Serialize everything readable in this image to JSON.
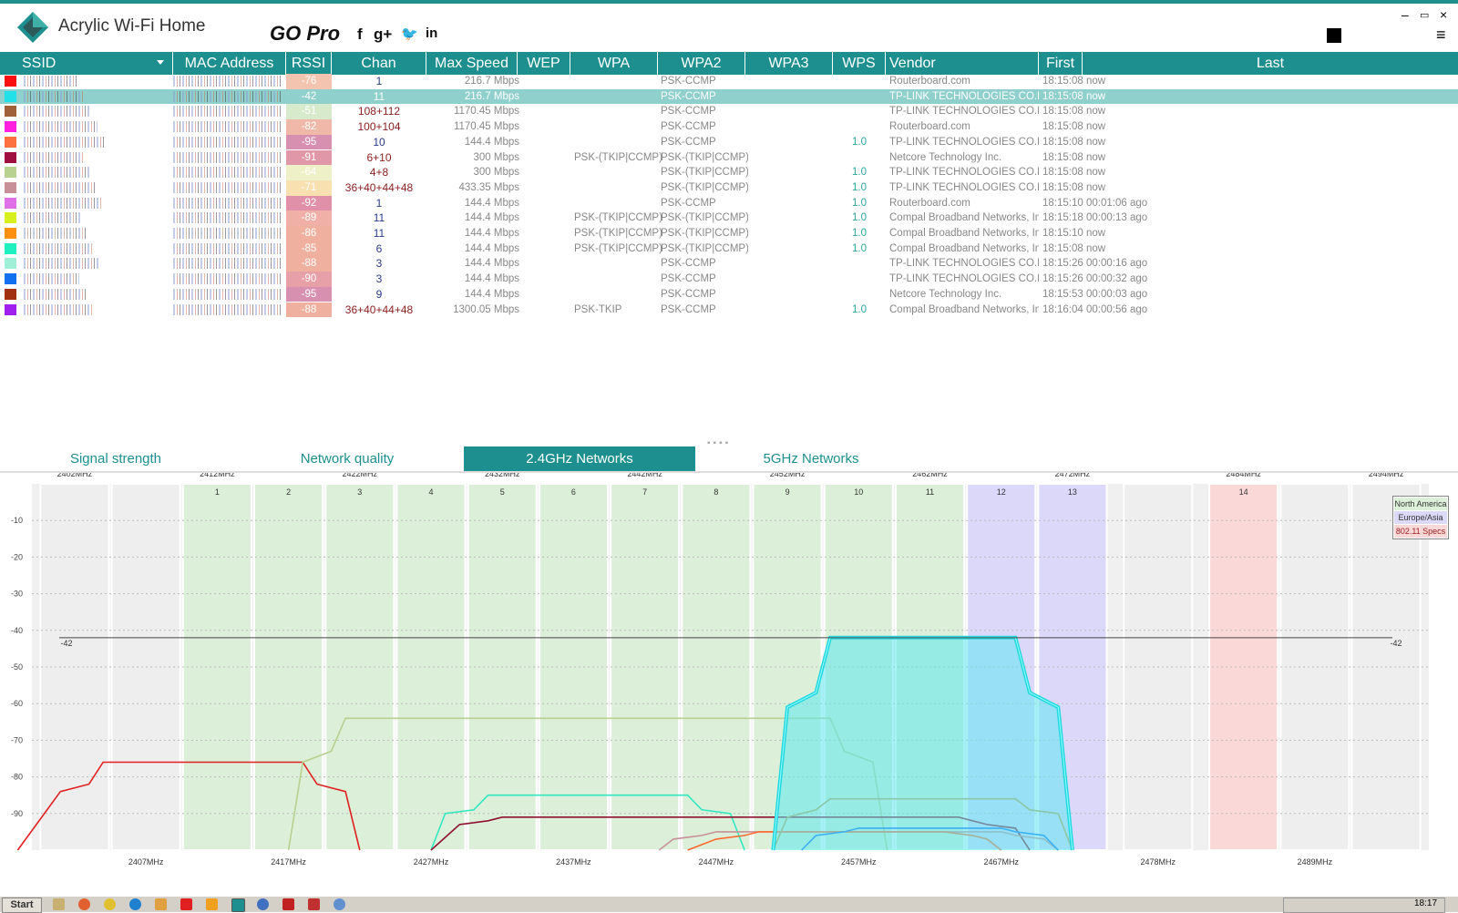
{
  "app": {
    "title": "Acrylic Wi-Fi Home",
    "go_pro": "GO Pro",
    "social": [
      "f",
      "g+",
      "🐦",
      "in"
    ],
    "window_buttons": [
      "×",
      "▭",
      "–"
    ]
  },
  "columns": [
    "SSID",
    "MAC Address",
    "RSSI",
    "Chan",
    "Max Speed",
    "WEP",
    "WPA",
    "WPA2",
    "WPA3",
    "WPS",
    "Vendor",
    "First",
    "Last"
  ],
  "rows": [
    {
      "color": "#ff1010",
      "rssi": "-76",
      "rssi_color": "#f3c4b0",
      "chan": "1",
      "speed": "216.7 Mbps",
      "wpa": "",
      "wpa2": "PSK-CCMP",
      "wps": "",
      "vendor": "Routerboard.com",
      "first": "18:15:08",
      "last": "now"
    },
    {
      "color": "#22e0e8",
      "rssi": "-42",
      "rssi_color": "#8fcfcc",
      "chan": "11",
      "speed": "216.7 Mbps",
      "wpa": "",
      "wpa2": "PSK-CCMP",
      "wps": "",
      "vendor": "TP-LINK TECHNOLOGIES CO.LTD",
      "first": "18:15:08",
      "last": "now",
      "selected": true
    },
    {
      "color": "#a0603a",
      "rssi": "-51",
      "rssi_color": "#d8eacc",
      "chan": "108+112",
      "speed": "1170.45 Mbps",
      "wpa": "",
      "wpa2": "PSK-CCMP",
      "wps": "",
      "vendor": "TP-LINK TECHNOLOGIES CO.LTD",
      "first": "18:15:08",
      "last": "now"
    },
    {
      "color": "#ff20e0",
      "rssi": "-82",
      "rssi_color": "#f0b8a8",
      "chan": "100+104",
      "speed": "1170.45 Mbps",
      "wpa": "",
      "wpa2": "PSK-CCMP",
      "wps": "",
      "vendor": "Routerboard.com",
      "first": "18:15:08",
      "last": "now"
    },
    {
      "color": "#ff7040",
      "rssi": "-95",
      "rssi_color": "#d890b0",
      "chan": "10",
      "speed": "144.4 Mbps",
      "wpa": "",
      "wpa2": "PSK-CCMP",
      "wps": "1.0",
      "vendor": "TP-LINK TECHNOLOGIES CO.LTD",
      "first": "18:15:08",
      "last": "now"
    },
    {
      "color": "#a01040",
      "rssi": "-91",
      "rssi_color": "#e098a8",
      "chan": "6+10",
      "speed": "300 Mbps",
      "wpa": "PSK-(TKIP|CCMP)",
      "wpa2": "PSK-(TKIP|CCMP)",
      "wps": "",
      "vendor": "Netcore Technology Inc.",
      "first": "18:15:08",
      "last": "now"
    },
    {
      "color": "#b8d090",
      "rssi": "-64",
      "rssi_color": "#eef0c8",
      "chan": "4+8",
      "speed": "300 Mbps",
      "wpa": "",
      "wpa2": "PSK-(TKIP|CCMP)",
      "wps": "1.0",
      "vendor": "TP-LINK TECHNOLOGIES CO.LTD",
      "first": "18:15:08",
      "last": "now"
    },
    {
      "color": "#c89098",
      "rssi": "-71",
      "rssi_color": "#f8e0b0",
      "chan": "36+40+44+48",
      "speed": "433.35 Mbps",
      "wpa": "",
      "wpa2": "PSK-(TKIP|CCMP)",
      "wps": "1.0",
      "vendor": "TP-LINK TECHNOLOGIES CO.LTD",
      "first": "18:15:08",
      "last": "now"
    },
    {
      "color": "#e070e8",
      "rssi": "-92",
      "rssi_color": "#e090a8",
      "chan": "1",
      "speed": "144.4 Mbps",
      "wpa": "",
      "wpa2": "PSK-CCMP",
      "wps": "1.0",
      "vendor": "Routerboard.com",
      "first": "18:15:10",
      "last": "00:01:06 ago"
    },
    {
      "color": "#d8f020",
      "rssi": "-89",
      "rssi_color": "#f0b0a8",
      "chan": "11",
      "speed": "144.4 Mbps",
      "wpa": "PSK-(TKIP|CCMP)",
      "wpa2": "PSK-(TKIP|CCMP)",
      "wps": "1.0",
      "vendor": "Compal Broadband Networks, Inc.",
      "first": "18:15:18",
      "last": "00:00:13 ago"
    },
    {
      "color": "#ff9010",
      "rssi": "-86",
      "rssi_color": "#f0b0a0",
      "chan": "11",
      "speed": "144.4 Mbps",
      "wpa": "PSK-(TKIP|CCMP)",
      "wpa2": "PSK-(TKIP|CCMP)",
      "wps": "1.0",
      "vendor": "Compal Broadband Networks, Inc.",
      "first": "18:15:10",
      "last": "now"
    },
    {
      "color": "#20f0c0",
      "rssi": "-85",
      "rssi_color": "#f0b0a0",
      "chan": "6",
      "speed": "144.4 Mbps",
      "wpa": "PSK-(TKIP|CCMP)",
      "wpa2": "PSK-(TKIP|CCMP)",
      "wps": "1.0",
      "vendor": "Compal Broadband Networks, Inc.",
      "first": "18:15:08",
      "last": "now"
    },
    {
      "color": "#a0f0d8",
      "rssi": "-88",
      "rssi_color": "#f0b0a0",
      "chan": "3",
      "speed": "144.4 Mbps",
      "wpa": "",
      "wpa2": "PSK-CCMP",
      "wps": "",
      "vendor": "TP-LINK TECHNOLOGIES CO.LTD",
      "first": "18:15:26",
      "last": "00:00:16 ago"
    },
    {
      "color": "#1070f0",
      "rssi": "-90",
      "rssi_color": "#e8a0a8",
      "chan": "3",
      "speed": "144.4 Mbps",
      "wpa": "",
      "wpa2": "PSK-CCMP",
      "wps": "",
      "vendor": "TP-LINK TECHNOLOGIES CO.LTD",
      "first": "18:15:26",
      "last": "00:00:32 ago"
    },
    {
      "color": "#a03010",
      "rssi": "-95",
      "rssi_color": "#d890b0",
      "chan": "9",
      "speed": "144.4 Mbps",
      "wpa": "",
      "wpa2": "PSK-CCMP",
      "wps": "",
      "vendor": "Netcore Technology Inc.",
      "first": "18:15:53",
      "last": "00:00:03 ago"
    },
    {
      "color": "#a020f0",
      "rssi": "-88",
      "rssi_color": "#f0b0a0",
      "chan": "36+40+44+48",
      "speed": "1300.05 Mbps",
      "wpa": "PSK-TKIP",
      "wpa2": "PSK-CCMP",
      "wps": "1.0",
      "vendor": "Compal Broadband Networks, Inc.",
      "first": "18:16:04",
      "last": "00:00:56 ago"
    }
  ],
  "tabs": [
    "Signal strength",
    "Network quality",
    "2.4GHz Networks",
    "5GHz Networks"
  ],
  "active_tab": "2.4GHz Networks",
  "splitter": "▪▪▪▪",
  "chart_data": {
    "type": "area",
    "top_freq_labels": [
      "2402MHz",
      "2412MHz",
      "2422MHz",
      "2432MHz",
      "2442MHz",
      "2452MHz",
      "2462MHz",
      "2472MHz",
      "2484MHz",
      "2494MHz"
    ],
    "bottom_freq_labels": [
      "2407MHz",
      "2417MHz",
      "2427MHz",
      "2437MHz",
      "2447MHz",
      "2457MHz",
      "2467MHz",
      "2478MHz",
      "2489MHz"
    ],
    "channel_labels": [
      "1",
      "2",
      "3",
      "4",
      "5",
      "6",
      "7",
      "8",
      "9",
      "10",
      "11",
      "12",
      "13",
      "14"
    ],
    "y_ticks": [
      "-10",
      "-20",
      "-30",
      "-40",
      "-50",
      "-60",
      "-70",
      "-80",
      "-90"
    ],
    "ylim": [
      -100,
      0
    ],
    "reference_line": {
      "value": -42,
      "label": "-42"
    },
    "legend": [
      "North America",
      "Europe/Asia",
      "802.11 Specs"
    ],
    "legend_colors": [
      "#dcefd8",
      "#dcd8fa",
      "#fbd8d8"
    ],
    "series": [
      {
        "color": "#e02020",
        "pts": [
          [
            2398,
            -100
          ],
          [
            2401,
            -84
          ],
          [
            2403,
            -82
          ],
          [
            2404,
            -76
          ],
          [
            2418,
            -76
          ],
          [
            2419,
            -82
          ],
          [
            2421,
            -84
          ],
          [
            2422,
            -100
          ]
        ]
      },
      {
        "color": "#b8d090",
        "pts": [
          [
            2417,
            -100
          ],
          [
            2418,
            -76
          ],
          [
            2420,
            -73
          ],
          [
            2421,
            -64
          ],
          [
            2455,
            -64
          ],
          [
            2456,
            -73
          ],
          [
            2458,
            -76
          ],
          [
            2459,
            -100
          ]
        ]
      },
      {
        "color": "#30e8c0",
        "pts": [
          [
            2427,
            -100
          ],
          [
            2428,
            -90
          ],
          [
            2430,
            -89
          ],
          [
            2431,
            -85
          ],
          [
            2445,
            -85
          ],
          [
            2446,
            -89
          ],
          [
            2448,
            -90
          ],
          [
            2449,
            -100
          ]
        ]
      },
      {
        "color": "#901030",
        "pts": [
          [
            2427,
            -100
          ],
          [
            2429,
            -93
          ],
          [
            2431,
            -92
          ],
          [
            2432,
            -91
          ],
          [
            2464,
            -91
          ],
          [
            2466,
            -93
          ],
          [
            2468,
            -94
          ],
          [
            2469,
            -100
          ]
        ]
      },
      {
        "color": "#c89098",
        "pts": [
          [
            2443,
            -100
          ],
          [
            2444,
            -97
          ],
          [
            2446,
            -96
          ],
          [
            2447,
            -95
          ],
          [
            2467,
            -95
          ],
          [
            2468,
            -96
          ],
          [
            2470,
            -97
          ],
          [
            2471,
            -100
          ]
        ]
      },
      {
        "color": "#ff6a30",
        "pts": [
          [
            2445,
            -100
          ],
          [
            2447,
            -97
          ],
          [
            2449,
            -96
          ],
          [
            2450,
            -95
          ],
          [
            2463,
            -95
          ],
          [
            2465,
            -96
          ],
          [
            2466,
            -97
          ],
          [
            2467,
            -100
          ]
        ]
      },
      {
        "color": "#c0a050",
        "pts": [
          [
            2451,
            -100
          ],
          [
            2452,
            -91
          ],
          [
            2454,
            -89
          ],
          [
            2455,
            -86
          ],
          [
            2468,
            -86
          ],
          [
            2469,
            -89
          ],
          [
            2471,
            -90
          ],
          [
            2472,
            -100
          ]
        ]
      },
      {
        "color": "#1070f0",
        "pts": [
          [
            2453,
            -100
          ],
          [
            2454,
            -96
          ],
          [
            2456,
            -95
          ],
          [
            2457,
            -94
          ],
          [
            2467,
            -94
          ],
          [
            2468,
            -95
          ],
          [
            2470,
            -96
          ],
          [
            2471,
            -100
          ]
        ]
      }
    ],
    "highlight_series": {
      "color": "#22d8e0",
      "fill": "#5fe8f0",
      "pts": [
        [
          2451,
          -100
        ],
        [
          2452,
          -61
        ],
        [
          2454,
          -57
        ],
        [
          2455,
          -42
        ],
        [
          2468,
          -42
        ],
        [
          2469,
          -57
        ],
        [
          2471,
          -61
        ],
        [
          2472,
          -100
        ]
      ]
    }
  },
  "taskbar": {
    "start": "Start",
    "clock": "18:17"
  }
}
